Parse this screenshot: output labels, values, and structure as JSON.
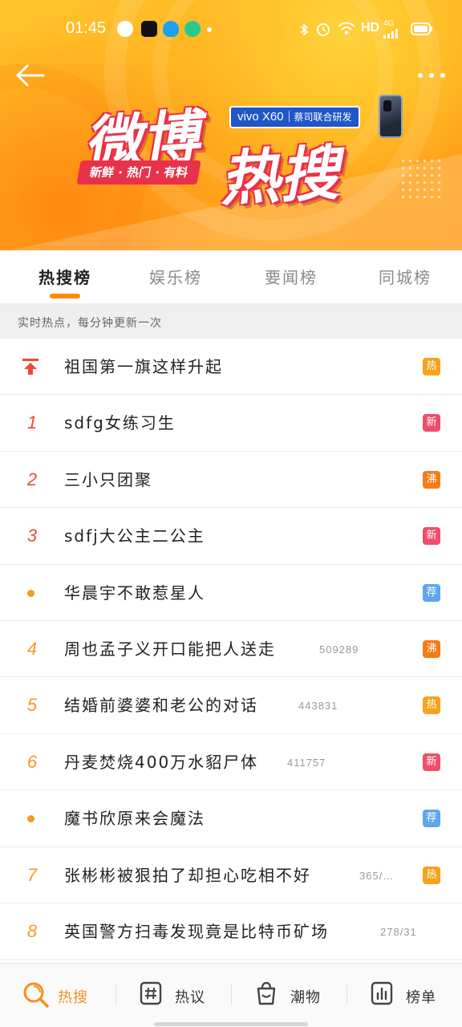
{
  "status_bar": {
    "time": "01:45",
    "network": "HD",
    "signal": "4G"
  },
  "banner": {
    "logo_text_1": "微博",
    "logo_text_2": "热搜",
    "tagline": "新鲜 · 热门 · 有料",
    "sponsor_brand": "vivo X60",
    "sponsor_tag": "蔡司联合研发",
    "colors": {
      "bg": "#ffae1f",
      "logo_red": "#e9314a",
      "sponsor_blue": "#1f57c7"
    }
  },
  "tabs": [
    {
      "label": "热搜榜",
      "active": true
    },
    {
      "label": "娱乐榜",
      "active": false
    },
    {
      "label": "要闻榜",
      "active": false
    },
    {
      "label": "同城榜",
      "active": false
    }
  ],
  "subtitle": "实时热点，每分钟更新一次",
  "items": [
    {
      "rank": "",
      "rank_type": "pin",
      "title": "祖国第一旗这样升起",
      "count": "",
      "badge": "热",
      "badge_color": "#f7a21b"
    },
    {
      "rank": "1",
      "rank_type": "red",
      "title": "sdfg女练习生",
      "count": "",
      "badge": "新",
      "badge_color": "#ef4e6a"
    },
    {
      "rank": "2",
      "rank_type": "red",
      "title": "三小只团聚",
      "count": "",
      "badge": "沸",
      "badge_color": "#f57c18"
    },
    {
      "rank": "3",
      "rank_type": "red",
      "title": "sdfj大公主二公主",
      "count": "",
      "badge": "新",
      "badge_color": "#ef4e6a"
    },
    {
      "rank": "",
      "rank_type": "dot",
      "title": "华晨宇不敢惹星人",
      "count": "",
      "badge": "荐",
      "badge_color": "#5fa6ee"
    },
    {
      "rank": "4",
      "rank_type": "orange",
      "title": "周也孟子义开口能把人送走",
      "count": "509289",
      "badge": "沸",
      "badge_color": "#f57c18"
    },
    {
      "rank": "5",
      "rank_type": "orange",
      "title": "结婚前婆婆和老公的对话",
      "count": "443831",
      "badge": "热",
      "badge_color": "#f7a21b"
    },
    {
      "rank": "6",
      "rank_type": "orange",
      "title": "丹麦焚烧400万水貂尸体",
      "count": "411757",
      "badge": "新",
      "badge_color": "#ef4e6a"
    },
    {
      "rank": "",
      "rank_type": "dot",
      "title": "魔书欣原来会魔法",
      "count": "",
      "badge": "荐",
      "badge_color": "#5fa6ee"
    },
    {
      "rank": "7",
      "rank_type": "orange",
      "title": "张彬彬被狠拍了却担心吃相不好",
      "count": "365/…",
      "badge": "热",
      "badge_color": "#f7a21b"
    },
    {
      "rank": "8",
      "rank_type": "orange",
      "title": "英国警方扫毒发现竟是比特币矿场",
      "count": "278/31",
      "badge": "",
      "badge_color": ""
    }
  ],
  "bottom_nav": [
    {
      "label": "热搜",
      "icon": "search-icon",
      "active": true
    },
    {
      "label": "热议",
      "icon": "hashtag-icon",
      "active": false
    },
    {
      "label": "潮物",
      "icon": "bag-icon",
      "active": false
    },
    {
      "label": "榜单",
      "icon": "chart-icon",
      "active": false
    }
  ],
  "accent_color": "#f5901e"
}
